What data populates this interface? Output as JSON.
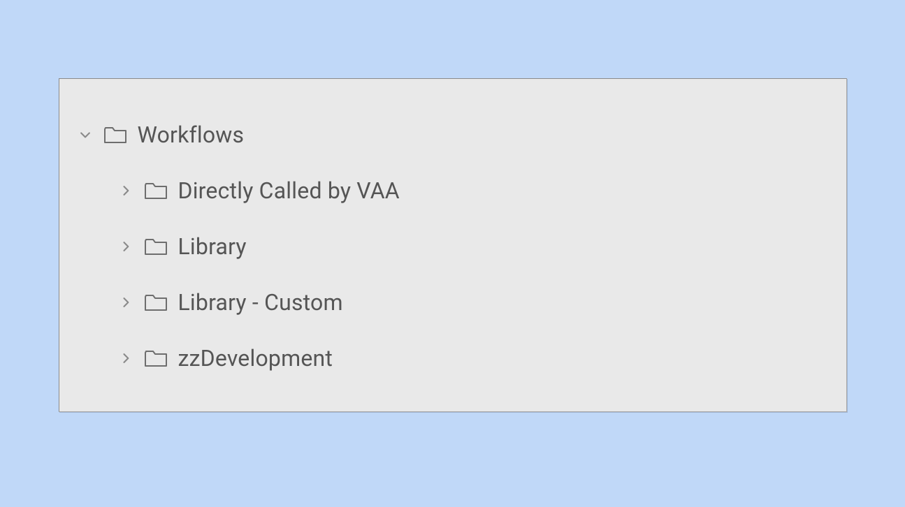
{
  "tree": {
    "root": {
      "label": "Workflows",
      "expanded": true,
      "children": [
        {
          "label": "Directly Called by VAA",
          "expanded": false
        },
        {
          "label": "Library",
          "expanded": false
        },
        {
          "label": "Library - Custom",
          "expanded": false
        },
        {
          "label": "zzDevelopment",
          "expanded": false
        }
      ]
    }
  }
}
